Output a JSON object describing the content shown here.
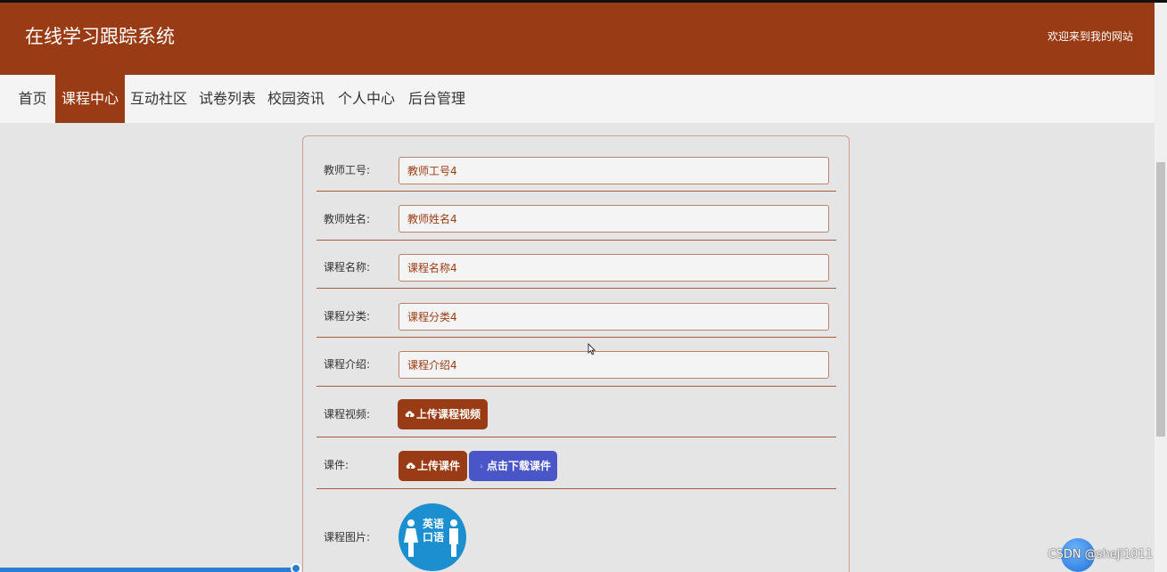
{
  "header": {
    "site_title": "在线学习跟踪系统",
    "welcome": "欢迎来到我的网站"
  },
  "nav": {
    "items": [
      {
        "label": "首页",
        "active": false
      },
      {
        "label": "课程中心",
        "active": true
      },
      {
        "label": "互动社区",
        "active": false
      },
      {
        "label": "试卷列表",
        "active": false
      },
      {
        "label": "校园资讯",
        "active": false
      },
      {
        "label": "个人中心",
        "active": false
      },
      {
        "label": "后台管理",
        "active": false
      }
    ]
  },
  "form": {
    "teacher_id": {
      "label": "教师工号:",
      "value": "教师工号4"
    },
    "teacher_name": {
      "label": "教师姓名:",
      "value": "教师姓名4"
    },
    "course_name": {
      "label": "课程名称:",
      "value": "课程名称4"
    },
    "course_category": {
      "label": "课程分类:",
      "value": "课程分类4"
    },
    "course_intro": {
      "label": "课程介绍:",
      "value": "课程介绍4"
    },
    "course_video": {
      "label": "课程视频:",
      "upload_label": "上传课程视频"
    },
    "courseware": {
      "label": "课件:",
      "upload_label": "上传课件",
      "download_label": "点击下载课件"
    },
    "course_image": {
      "label": "课程图片:",
      "image_text_top": "英语",
      "image_text_bottom": "口语"
    }
  },
  "watermark": "CSDN @sheji1011",
  "colors": {
    "brand": "#993b14",
    "download_button": "#4a56c8",
    "background": "#e6e5e5",
    "nav_background": "#f5f4f4"
  },
  "icons": {
    "upload": "cloud-upload-icon",
    "download": "download-icon"
  }
}
